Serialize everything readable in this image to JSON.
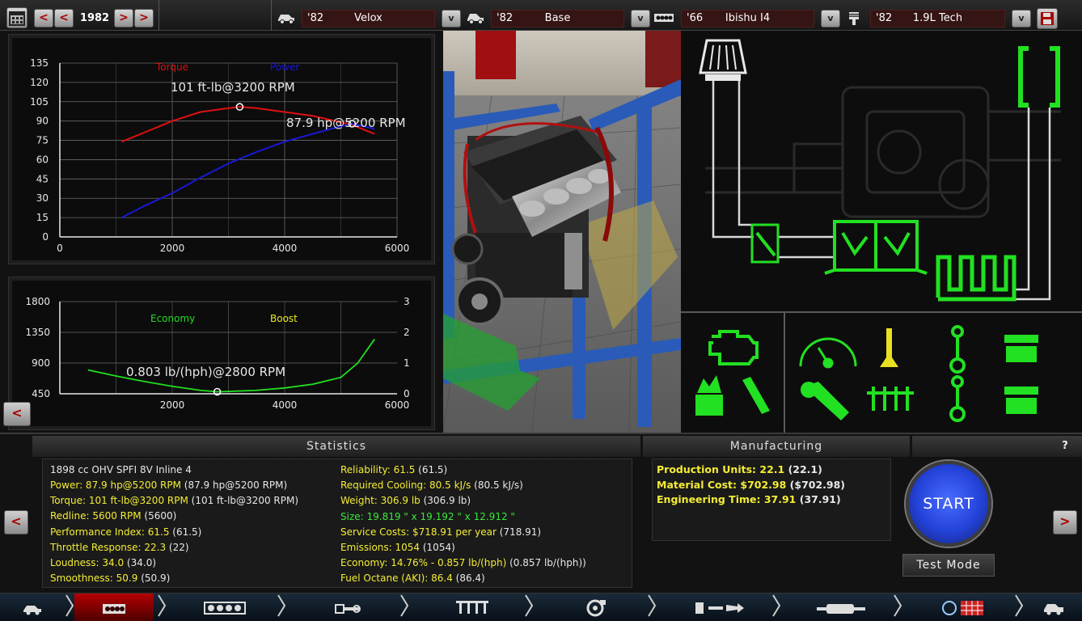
{
  "topbar": {
    "year": "1982",
    "calendar_icon": "calendar-icon",
    "model": {
      "year": "'82",
      "name": "Velox"
    },
    "trim": {
      "year": "'82",
      "name": "Base"
    },
    "engine_family": {
      "year": "'66",
      "name": "Ibishu I4"
    },
    "engine_variant": {
      "year": "'82",
      "name": "1.9L Tech"
    },
    "prev_label": "<",
    "next_label": ">",
    "dropdown_label": "v"
  },
  "power_chart": {
    "type": "line",
    "legend_torque": "Torque",
    "legend_power": "Power",
    "y_ticks": [
      "135",
      "120",
      "105",
      "90",
      "75",
      "60",
      "45",
      "30",
      "15",
      "0"
    ],
    "x_ticks": [
      "0",
      "2000",
      "4000",
      "6000"
    ],
    "peak_torque_label": "101 ft-lb@3200 RPM",
    "peak_power_label": "87.9 hp@5200 RPM",
    "colors": {
      "torque": "#e01010",
      "power": "#1818d8"
    }
  },
  "economy_chart": {
    "type": "line",
    "legend_economy": "Economy",
    "legend_boost": "Boost",
    "y_left_ticks": [
      "1800",
      "1350",
      "900",
      "450"
    ],
    "y_right_ticks": [
      "3",
      "2",
      "1",
      "0"
    ],
    "x_ticks": [
      "2000",
      "4000",
      "6000"
    ],
    "best_economy_label": "0.803 lb/(hph)@2800 RPM",
    "colors": {
      "economy": "#22dd22",
      "boost": "#e8e820"
    }
  },
  "chart_data": [
    {
      "type": "line",
      "x_axis": "RPM",
      "xlim": [
        0,
        6000
      ],
      "ylim": [
        0,
        135
      ],
      "series": [
        {
          "name": "Torque",
          "x": [
            1100,
            1500,
            2000,
            2500,
            3000,
            3200,
            3500,
            4000,
            4500,
            5000,
            5200,
            5600
          ],
          "y": [
            74,
            81,
            90,
            97,
            100,
            101,
            100,
            97,
            94,
            89,
            87,
            80
          ]
        },
        {
          "name": "Power",
          "x": [
            1100,
            1500,
            2000,
            2500,
            3000,
            3500,
            4000,
            4500,
            5000,
            5200,
            5600
          ],
          "y": [
            15,
            24,
            34,
            46,
            57,
            66,
            74,
            80,
            86,
            87.9,
            84
          ]
        }
      ],
      "annotations": [
        "101 ft-lb@3200 RPM",
        "87.9 hp@5200 RPM"
      ]
    },
    {
      "type": "line",
      "x_axis": "RPM",
      "xlim": [
        0,
        6000
      ],
      "ylim": [
        450,
        1800
      ],
      "y2lim": [
        0,
        3
      ],
      "series": [
        {
          "name": "Economy",
          "x": [
            500,
            1000,
            1500,
            2000,
            2500,
            2800,
            3000,
            3500,
            4000,
            4500,
            5000,
            5300,
            5600
          ],
          "y": [
            800,
            710,
            630,
            560,
            500,
            480,
            485,
            500,
            535,
            590,
            690,
            900,
            1250
          ]
        },
        {
          "name": "Boost",
          "x": [],
          "y": []
        }
      ],
      "annotations": [
        "0.803 lb/(hph)@2800 RPM"
      ]
    }
  ],
  "back_label": "<",
  "schematic": {
    "icons": [
      "air-filter-icon",
      "exhaust-outlet-icon",
      "throttle-icon",
      "intake-manifold-icon",
      "exhaust-header-icon",
      "check-engine-icon",
      "gauge-icon",
      "valve-icon",
      "conrod-icon",
      "piston-icon",
      "spark-fuel-icon",
      "injector-icon",
      "tuning-wrench-icon",
      "crankshaft-icon"
    ]
  },
  "statistics": {
    "title": "Statistics",
    "engine_desc": "1898 cc OHV SPFI 8V Inline 4",
    "left": [
      {
        "label": "Power: 87.9 hp@5200 RPM",
        "value": " (87.9 hp@5200 RPM)"
      },
      {
        "label": "Torque: 101 ft-lb@3200 RPM",
        "value": " (101 ft-lb@3200 RPM)"
      },
      {
        "label": "Redline: 5600 RPM",
        "value": " (5600)"
      },
      {
        "label": "Performance Index: 61.5",
        "value": " (61.5)"
      },
      {
        "label": "Throttle Response: 22.3",
        "value": " (22)"
      },
      {
        "label": "Loudness: 34.0",
        "value": " (34.0)"
      },
      {
        "label": "Smoothness: 50.9",
        "value": " (50.9)"
      }
    ],
    "right": [
      {
        "label": "Reliability: 61.5",
        "value": " (61.5)"
      },
      {
        "label": "Required Cooling: 80.5 kJ/s",
        "value": " (80.5 kJ/s)"
      },
      {
        "label": "Weight: 306.9 lb",
        "value": " (306.9 lb)"
      },
      {
        "label": "Size: 19.819 \" x 19.192 \" x 12.912 \"",
        "value": ""
      },
      {
        "label": "Service Costs: $718.91 per year",
        "value": " (718.91)"
      },
      {
        "label": "Emissions: 1054",
        "value": " (1054)"
      },
      {
        "label": "Economy: 14.76% - 0.857 lb/(hph)",
        "value": " (0.857 lb/(hph))"
      },
      {
        "label": "Fuel Octane (AKI): 86.4",
        "value": " (86.4)"
      }
    ]
  },
  "manufacturing": {
    "title": "Manufacturing",
    "help": "?",
    "rows": [
      {
        "label": "Production Units: 22.1",
        "value": " (22.1)"
      },
      {
        "label": "Material Cost: $702.98",
        "value": " ($702.98)"
      },
      {
        "label": "Engineering Time: 37.91",
        "value": " (37.91)"
      }
    ],
    "start": "START",
    "test_mode": "Test Mode"
  },
  "nav": {
    "prev": "<",
    "next": ">"
  },
  "footer_tabs": [
    "car-icon",
    "engine-block-icon",
    "cylinder-head-icon",
    "crank-icon",
    "valvetrain-icon",
    "turbo-icon",
    "fuel-system-icon",
    "exhaust-icon",
    "tuning-icon",
    "test-car-icon"
  ]
}
